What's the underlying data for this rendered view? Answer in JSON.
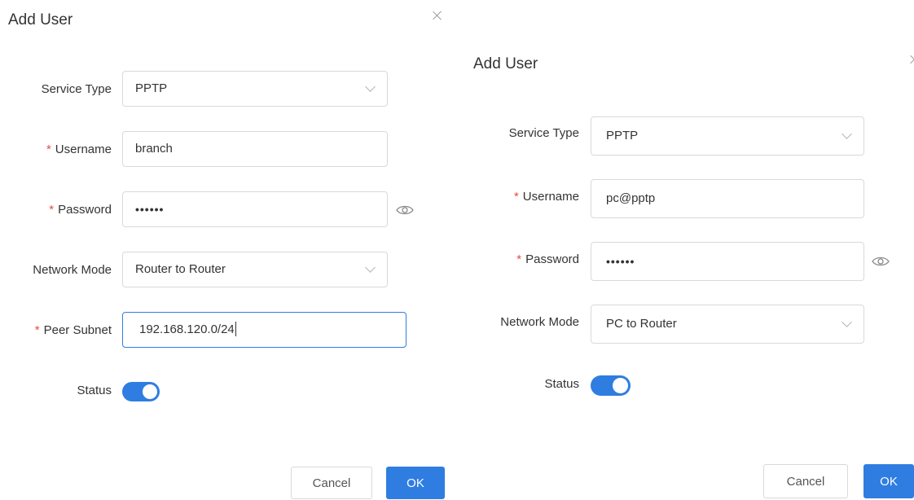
{
  "dialog_left": {
    "title": "Add User",
    "service_type": {
      "label": "Service Type",
      "value": "PPTP"
    },
    "username": {
      "required_mark": "*",
      "label": "Username",
      "value": "branch"
    },
    "password": {
      "required_mark": "*",
      "label": "Password",
      "value": "••••••"
    },
    "network_mode": {
      "label": "Network Mode",
      "value": "Router to Router"
    },
    "peer_subnet": {
      "required_mark": "*",
      "label": "Peer Subnet",
      "value": "192.168.120.0/24"
    },
    "status": {
      "label": "Status",
      "enabled": true
    },
    "cancel_label": "Cancel",
    "ok_label": "OK"
  },
  "dialog_right": {
    "title": "Add User",
    "service_type": {
      "label": "Service Type",
      "value": "PPTP"
    },
    "username": {
      "required_mark": "*",
      "label": "Username",
      "value": "pc@pptp"
    },
    "password": {
      "required_mark": "*",
      "label": "Password",
      "value": "••••••"
    },
    "network_mode": {
      "label": "Network Mode",
      "value": "PC to Router"
    },
    "status": {
      "label": "Status",
      "enabled": true
    },
    "cancel_label": "Cancel",
    "ok_label": "OK"
  },
  "colors": {
    "accent": "#2f7de1",
    "required": "#e84b3c",
    "border": "#d9d9d9"
  }
}
